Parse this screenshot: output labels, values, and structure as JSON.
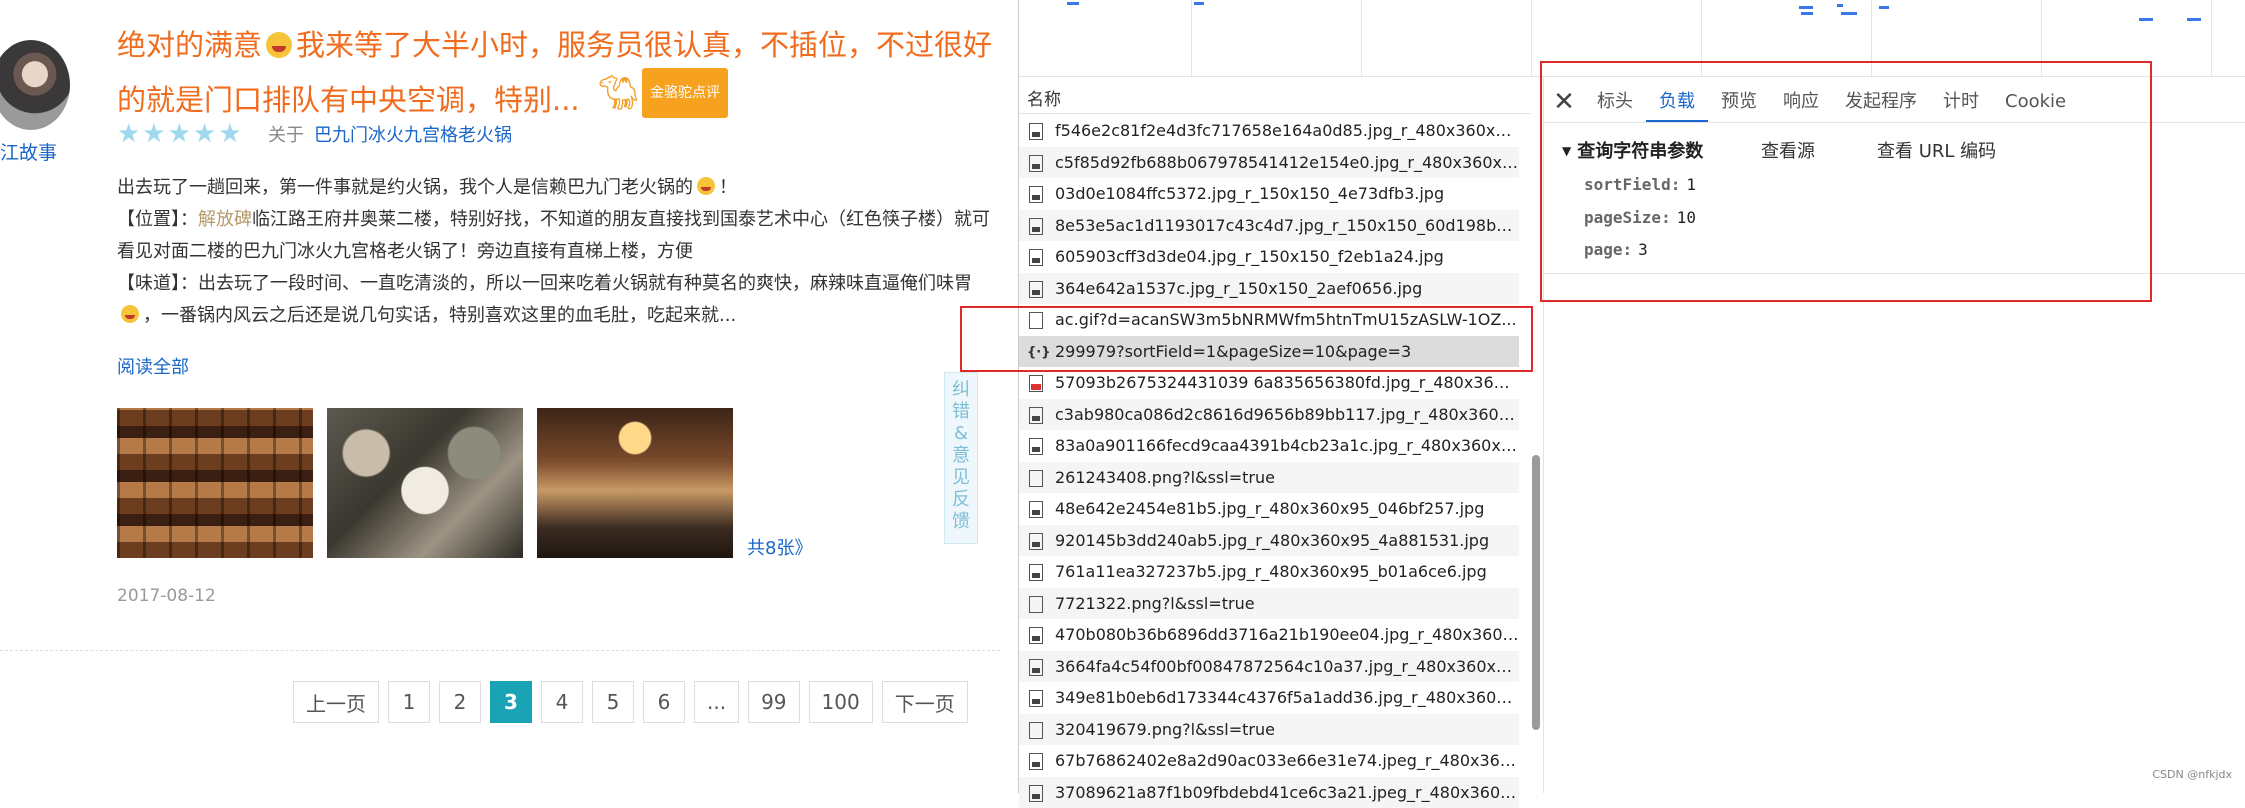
{
  "review": {
    "username": "江故事",
    "title_part1": "绝对的满意",
    "title_part2": "我来等了大半小时，服务员很认真，不插位，不过很好的就是门口排队有中央空调，特别...",
    "badge_label": "金骆驼点评",
    "stars": "★★★★★",
    "about_prefix": "关于",
    "about_link": "巴九门冰火九宫格老火锅",
    "body_line1": "出去玩了一趟回来，第一件事就是约火锅，我个人是信赖巴九门老火锅的",
    "body_loc_label": "【位置】：",
    "body_loc_place": "解放碑",
    "body_loc_text": "临江路王府井奥莱二楼，特别好找，不知道的朋友直接找到国泰艺术中心（红色筷子楼）就可看见对面二楼的巴九门冰火九宫格老火锅了！旁边直接有直梯上楼，方便",
    "body_taste_label": "【味道】：",
    "body_taste_text": "出去玩了一段时间、一直吃清淡的，所以一回来吃着火锅就有种莫名的爽快，麻辣味直逼俺们味胃",
    "body_taste_text2": "，一番锅内风云之后还是说几句实话，特别喜欢这里的血毛肚，吃起来就...",
    "read_all": "阅读全部",
    "total_photos": "共8张》",
    "date": "2017-08-12",
    "feedback": [
      "纠",
      "错",
      "&",
      "意",
      "见",
      "反",
      "馈"
    ]
  },
  "pager": {
    "prev": "上一页",
    "pages": [
      "1",
      "2",
      "3",
      "4",
      "5",
      "6",
      "...",
      "99",
      "100"
    ],
    "active": "3",
    "next": "下一页"
  },
  "devtools": {
    "name_header": "名称",
    "requests": [
      {
        "name": "f546e2c81f2e4d3fc717658e164a0d85.jpg_r_480x360x95_...",
        "icon": "img"
      },
      {
        "name": "c5f85d92fb688b067978541412e154e0.jpg_r_480x360x95...",
        "icon": "img"
      },
      {
        "name": "03d0e1084ffc5372.jpg_r_150x150_4e73dfb3.jpg",
        "icon": "img"
      },
      {
        "name": "8e53e5ac1d1193017c43c4d7.jpg_r_150x150_60d198b4.jpg",
        "icon": "img"
      },
      {
        "name": "605903cff3d3de04.jpg_r_150x150_f2eb1a24.jpg",
        "icon": "img"
      },
      {
        "name": "364e642a1537c.jpg_r_150x150_2aef0656.jpg",
        "icon": "img"
      },
      {
        "name": "ac.gif?d=acanSW3m5bNRMWfm5htnTmU15zASLW-1OZ...",
        "icon": "doc"
      },
      {
        "name": "299979?sortField=1&pageSize=10&page=3",
        "icon": "xhr"
      },
      {
        "name": "57093b2675324431039 6a835656380fd.jpg_r_480x360x9...",
        "icon": "red"
      },
      {
        "name": "c3ab980ca086d2c8616d9656b89bb117.jpg_r_480x360x9...",
        "icon": "img"
      },
      {
        "name": "83a0a901166fecd9caa4391b4cb23a1c.jpg_r_480x360x95...",
        "icon": "img"
      },
      {
        "name": "261243408.png?l&ssl=true",
        "icon": "doc"
      },
      {
        "name": "48e642e2454e81b5.jpg_r_480x360x95_046bf257.jpg",
        "icon": "img"
      },
      {
        "name": "920145b3dd240ab5.jpg_r_480x360x95_4a881531.jpg",
        "icon": "img"
      },
      {
        "name": "761a11ea327237b5.jpg_r_480x360x95_b01a6ce6.jpg",
        "icon": "img"
      },
      {
        "name": "7721322.png?l&ssl=true",
        "icon": "doc"
      },
      {
        "name": "470b080b36b6896dd3716a21b190ee04.jpg_r_480x360x9...",
        "icon": "img"
      },
      {
        "name": "3664fa4c54f00bf00847872564c10a37.jpg_r_480x360x95_...",
        "icon": "img"
      },
      {
        "name": "349e81b0eb6d173344c4376f5a1add36.jpg_r_480x360x95...",
        "icon": "img"
      },
      {
        "name": "320419679.png?l&ssl=true",
        "icon": "doc"
      },
      {
        "name": "67b76862402e8a2d90ac033e66e31e74.jpeg_r_480x360x...",
        "icon": "img"
      },
      {
        "name": "37089621a87f1b09fbdebd41ce6c3a21.jpeg_r_480x360x9...",
        "icon": "img"
      }
    ],
    "selected_index": 7,
    "tabs": [
      "标头",
      "负载",
      "预览",
      "响应",
      "发起程序",
      "计时",
      "Cookie"
    ],
    "active_tab": "负载",
    "query_header": "查询字符串参数",
    "view_source": "查看源",
    "view_url_encoded": "查看 URL 编码",
    "params": [
      {
        "key": "sortField:",
        "value": "1"
      },
      {
        "key": "pageSize:",
        "value": "10"
      },
      {
        "key": "page:",
        "value": "3"
      }
    ]
  },
  "watermark": "CSDN @nfkjdx",
  "colors": {
    "accent_orange": "#f06c1e",
    "link_blue": "#1a66c9",
    "pager_active": "#1aa3b5",
    "highlight_red": "#e02a2a",
    "devtools_tab_active": "#1a66d2"
  }
}
